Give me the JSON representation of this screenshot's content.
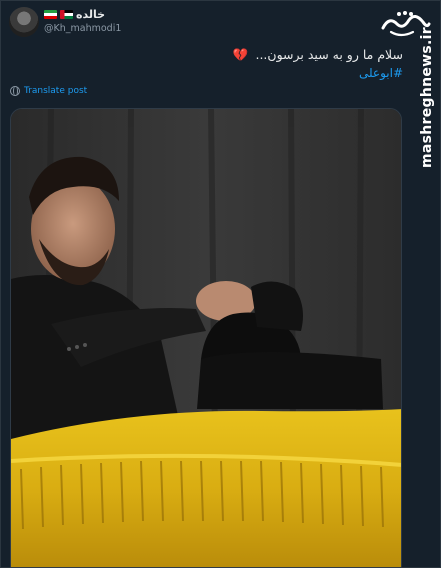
{
  "tweet": {
    "author_name": "خالده",
    "author_flags": [
      "palestine-flag",
      "iran-flag"
    ],
    "handle": "@Kh_mahmodi1",
    "text": "سلام ما رو به سید برسون...",
    "emoji": "broken-heart",
    "hashtag": "#ابوعلی",
    "translate_label": "Translate post"
  },
  "watermark": {
    "logo_text": "مشرق",
    "site": "mashreghnews.ir"
  },
  "colors": {
    "background": "#15202b",
    "link": "#1d9bf0",
    "muted": "#8b98a5",
    "flag_yellow": "#e3b618"
  }
}
